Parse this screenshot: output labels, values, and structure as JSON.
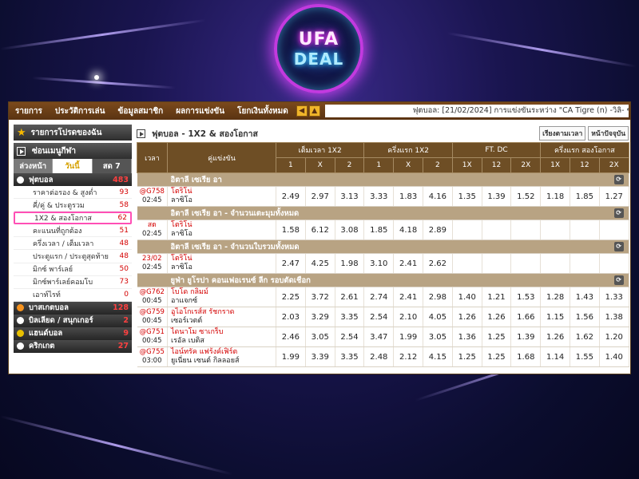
{
  "brand": {
    "line1": "UFA",
    "line2": "DEAL"
  },
  "nav": {
    "items": [
      "รายการ",
      "ประวัติการเล่น",
      "ข้อมูลสมาชิก",
      "ผลการแข่งขัน",
      "โยกเงินทั้งหมด"
    ],
    "ticker": "ฟุตบอล: [21/02/2024] การแข่งขันระหว่าง \"CA Tigre (n) -วิลิ- ช"
  },
  "sidebar": {
    "favorites": "รายการโปรดของฉัน",
    "hide_menu": "ซ่อนเมนูกีฬา",
    "tabs": [
      "ล่วงหน้า",
      "วันนี้",
      "สด 7"
    ],
    "sports": [
      {
        "name": "ฟุตบอล",
        "count": "483",
        "ball": "white"
      }
    ],
    "subs": [
      {
        "label": "ราคาต่อรอง & สูงต่ำ",
        "count": "93"
      },
      {
        "label": "คี่/คู่ & ประตูรวม",
        "count": "58"
      },
      {
        "label": "1X2 & สองโอกาส",
        "count": "62",
        "selected": true
      },
      {
        "label": "คะแนนที่ถูกต้อง",
        "count": "51"
      },
      {
        "label": "ครึ่งเวลา / เต็มเวลา",
        "count": "48"
      },
      {
        "label": "ประตูแรก / ประตูสุดท้าย",
        "count": "48"
      },
      {
        "label": "มิกซ์ พาร์เลย์",
        "count": "50"
      },
      {
        "label": "มิกซ์พาร์เลย์คอมโบ",
        "count": "73"
      },
      {
        "label": "เอาท์ไรท์",
        "count": "0"
      }
    ],
    "other_sports": [
      {
        "name": "บาสเกตบอล",
        "count": "128",
        "ball": "orange"
      },
      {
        "name": "บิลเลียด / สนุกเกอร์",
        "count": "2",
        "ball": "white"
      },
      {
        "name": "แฮนด์บอล",
        "count": "9",
        "ball": "yellow"
      },
      {
        "name": "คริกเกต",
        "count": "27",
        "ball": "white"
      }
    ]
  },
  "main": {
    "title": "ฟุตบอล - 1X2 & สองโอกาส",
    "btn_sort": "เรียงตามเวลา",
    "btn_today": "หน้าปัจจุบัน",
    "headers": {
      "time": "เวลา",
      "match": "คู่แข่งขัน",
      "ft1x2": "เต็มเวลา 1X2",
      "ht1x2": "ครึ่งแรก 1X2",
      "ftdc": "FT. DC",
      "htdc": "ครึ่งแรก สองโอกาส",
      "sub1": [
        "1",
        "X",
        "2"
      ],
      "sub2": [
        "1X",
        "12",
        "2X"
      ]
    },
    "leagues": [
      {
        "name": "อิตาลี เซเรีย อา",
        "matches": [
          {
            "code": "@G758",
            "time": "02:45",
            "home": "โตริโน่",
            "away": "ลาซิโอ",
            "odds": [
              "2.49",
              "2.97",
              "3.13",
              "3.33",
              "1.83",
              "4.16",
              "1.35",
              "1.39",
              "1.52",
              "1.18",
              "1.85",
              "1.27"
            ]
          }
        ]
      },
      {
        "name": "อิตาลี เซเรีย อา - จำนวนเตะมุมทั้งหมด",
        "matches": [
          {
            "code": "สด",
            "time": "02:45",
            "home": "โตริโน่",
            "away": "ลาซิโอ",
            "odds": [
              "1.58",
              "6.12",
              "3.08",
              "1.85",
              "4.18",
              "2.89",
              "",
              "",
              "",
              "",
              "",
              ""
            ]
          }
        ]
      },
      {
        "name": "อิตาลี เซเรีย อา - จำนวนใบรวมทั้งหมด",
        "matches": [
          {
            "code": "23/02",
            "time": "02:45",
            "home": "โตริโน่",
            "away": "ลาซิโอ",
            "odds": [
              "2.47",
              "4.25",
              "1.98",
              "3.10",
              "2.41",
              "2.62",
              "",
              "",
              "",
              "",
              "",
              ""
            ]
          }
        ]
      },
      {
        "name": "ยูฟ่า ยูโรปา คอนเฟอเรนซ์ ลีก รอบตัดเชือก",
        "matches": [
          {
            "code": "@G762",
            "time": "00:45",
            "home": "โบโด กลิมม์",
            "away": "อาแจกซ์",
            "odds": [
              "2.25",
              "3.72",
              "2.61",
              "2.74",
              "2.41",
              "2.98",
              "1.40",
              "1.21",
              "1.53",
              "1.28",
              "1.43",
              "1.33"
            ]
          },
          {
            "code": "@G759",
            "time": "00:45",
            "home": "อูไอโกเรส์ส รัชกราด",
            "away": "เซอร์เวตต์",
            "odds": [
              "2.03",
              "3.29",
              "3.35",
              "2.54",
              "2.10",
              "4.05",
              "1.26",
              "1.26",
              "1.66",
              "1.15",
              "1.56",
              "1.38"
            ]
          },
          {
            "code": "@G751",
            "time": "00:45",
            "home": "ไดนาโม ซาเกร็บ",
            "away": "เรอัล เบติส",
            "odds": [
              "2.46",
              "3.05",
              "2.54",
              "3.47",
              "1.99",
              "3.05",
              "1.36",
              "1.25",
              "1.39",
              "1.26",
              "1.62",
              "1.20"
            ]
          },
          {
            "code": "@G755",
            "time": "03:00",
            "home": "ไอน์ทรัค แฟร้งค์เฟิร์ต",
            "away": "ยูเนี่ยน เซนต์ กิลลอยส์",
            "odds": [
              "1.99",
              "3.39",
              "3.35",
              "2.48",
              "2.12",
              "4.15",
              "1.25",
              "1.25",
              "1.68",
              "1.14",
              "1.55",
              "1.40"
            ]
          }
        ]
      }
    ]
  }
}
